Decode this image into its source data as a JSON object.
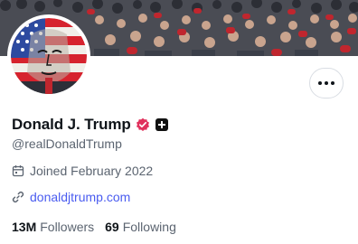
{
  "profile": {
    "display_name": "Donald J. Trump",
    "handle": "@realDonaldTrump",
    "joined": "Joined February 2022",
    "website": "donaldjtrump.com",
    "stats": [
      {
        "count": "13M",
        "label": "Followers"
      },
      {
        "count": "69",
        "label": "Following"
      }
    ]
  },
  "icons": {
    "more": "more-horizontal-icon",
    "verified": "verified-badge-icon",
    "badge": "plus-badge-icon",
    "calendar": "calendar-icon",
    "link": "link-icon"
  },
  "colors": {
    "accent": "#4a5cf0",
    "verified": "#e0305c",
    "muted_text": "#5b6470",
    "primary_text": "#0f1419"
  }
}
